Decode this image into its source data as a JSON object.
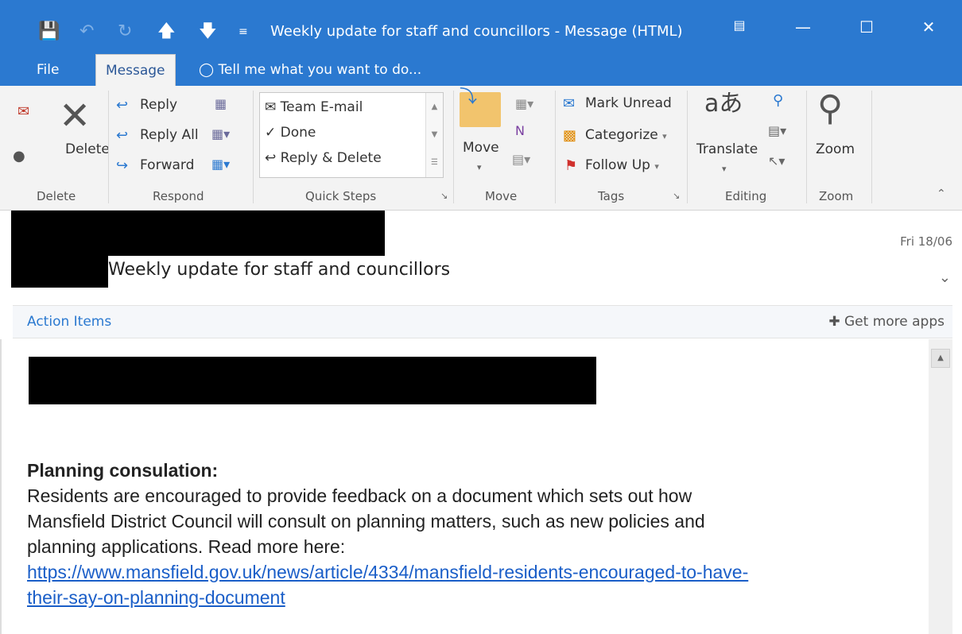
{
  "titlebar": {
    "title": "Weekly update for staff and councillors  - Message (HTML)",
    "qat_icons": [
      "save-icon",
      "undo-icon",
      "redo-icon",
      "up-arrow-icon",
      "down-arrow-icon",
      "customize-qat-icon"
    ],
    "controls": [
      "ribbon-display-icon",
      "minimize-icon",
      "maximize-icon",
      "close-icon"
    ]
  },
  "tabs": {
    "file": "File",
    "message": "Message",
    "tell_me": "Tell me what you want to do..."
  },
  "ribbon": {
    "delete_group": {
      "delete_label": "Delete",
      "group_label": "Delete"
    },
    "respond_group": {
      "reply": "Reply",
      "reply_all": "Reply All",
      "forward": "Forward",
      "group_label": "Respond"
    },
    "quick_steps": {
      "items": [
        "Team E-mail",
        "Done",
        "Reply & Delete"
      ],
      "group_label": "Quick Steps"
    },
    "move_group": {
      "move": "Move",
      "group_label": "Move"
    },
    "tags_group": {
      "mark_unread": "Mark Unread",
      "categorize": "Categorize",
      "follow_up": "Follow Up",
      "group_label": "Tags"
    },
    "editing_group": {
      "translate": "Translate",
      "group_label": "Editing"
    },
    "zoom_group": {
      "zoom": "Zoom",
      "group_label": "Zoom"
    }
  },
  "message": {
    "subject": "Weekly update for staff and councillors",
    "date": "Fri 18/06"
  },
  "action_bar": {
    "label": "Action Items",
    "get_more_apps": "Get more apps"
  },
  "body": {
    "heading": "Planning consulation:",
    "lines": [
      "Residents are encouraged to provide feedback on a document which sets out how",
      "Mansfield District Council will consult on planning matters, such as new policies and",
      "planning applications. Read more here:"
    ],
    "link_lines": [
      "https://www.mansfield.gov.uk/news/article/4334/mansfield-residents-encouraged-to-have-",
      "their-say-on-planning-document"
    ]
  }
}
